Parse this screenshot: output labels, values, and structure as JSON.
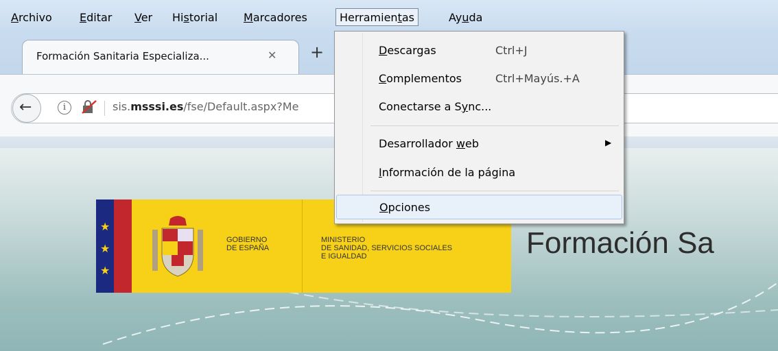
{
  "menubar": {
    "items": [
      {
        "pre": "",
        "key": "A",
        "post": "rchivo"
      },
      {
        "pre": "",
        "key": "E",
        "post": "ditar"
      },
      {
        "pre": "",
        "key": "V",
        "post": "er"
      },
      {
        "pre": "Hi",
        "key": "s",
        "post": "torial"
      },
      {
        "pre": "",
        "key": "M",
        "post": "arcadores"
      },
      {
        "pre": "Herramien",
        "key": "t",
        "post": "as"
      },
      {
        "pre": "Ay",
        "key": "u",
        "post": "da"
      }
    ]
  },
  "tabs": {
    "active_title": "Formación Sanitaria Especializa...",
    "close_glyph": "✕",
    "new_tab_glyph": "+"
  },
  "navbar": {
    "url_domain": "sis.msssi.es",
    "url_prefix": "sis.",
    "url_bold": "msssi.es",
    "url_path": "/fse/Default.aspx?Me"
  },
  "dropdown": {
    "items": [
      {
        "pre": "",
        "key": "D",
        "post": "escargas",
        "shortcut": "Ctrl+J"
      },
      {
        "pre": "",
        "key": "C",
        "post": "omplementos",
        "shortcut": "Ctrl+Mayús.+A"
      },
      {
        "pre": "Conectarse a S",
        "key": "y",
        "post": "nc...",
        "shortcut": ""
      },
      {
        "pre": "Desarrollador ",
        "key": "w",
        "post": "eb",
        "shortcut": "",
        "submenu": true
      },
      {
        "pre": "",
        "key": "I",
        "post": "nformación de la página",
        "shortcut": ""
      },
      {
        "pre": "",
        "key": "O",
        "post": "pciones",
        "shortcut": ""
      }
    ],
    "submenu_arrow": "▶"
  },
  "page": {
    "logo_gobierno": "GOBIERNO\nDE ESPAÑA",
    "logo_ministerio_1": "MINISTERIO",
    "logo_ministerio_2": "DE SANIDAD, SERVICIOS SOCIALES",
    "logo_ministerio_3": "E IGUALDAD",
    "site_title": "Formación Sa",
    "logo_colors": {
      "yellow": "#f7d117",
      "blue": "#1b2a80",
      "red": "#c1272d"
    }
  }
}
